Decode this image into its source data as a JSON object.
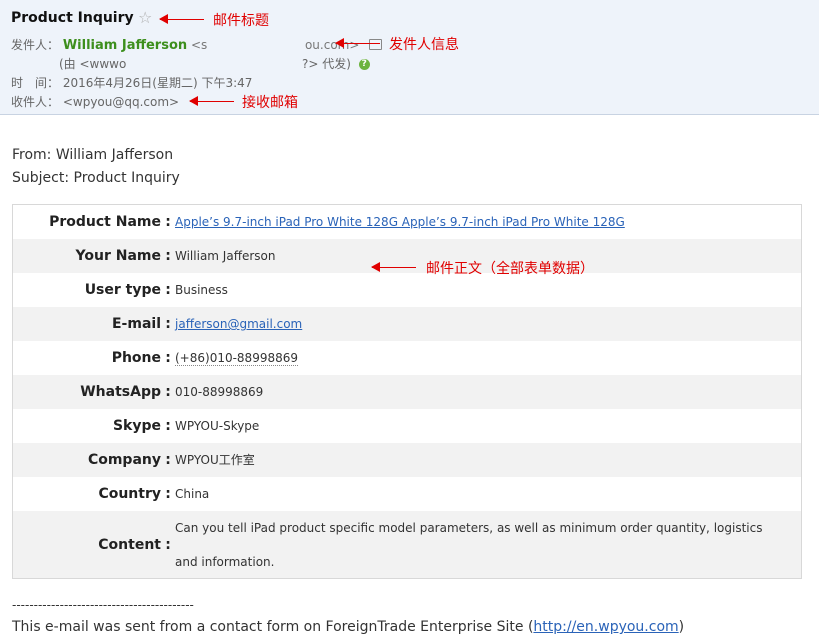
{
  "header": {
    "subject": "Product Inquiry",
    "from_label": "发件人：",
    "sender_name": "William Jafferson",
    "sender_addr_start": "<s",
    "sender_addr_end": "ou.com>",
    "relay_start": "(由 <wwwo",
    "relay_end": "?> 代发)",
    "time_label": "时　间：",
    "time_value": "2016年4月26日(星期二) 下午3:47",
    "to_label": "收件人：",
    "to_value": "<wpyou@qq.com>"
  },
  "annotations": {
    "subject": "邮件标题",
    "sender": "发件人信息",
    "recipient": "接收邮箱",
    "body": "邮件正文（全部表单数据）"
  },
  "body": {
    "from_line": "From: William Jafferson",
    "subject_line": "Subject: Product Inquiry",
    "rows": [
      {
        "label": "Product Name",
        "value": "Apple’s 9.7-inch iPad Pro White 128G Apple’s 9.7-inch iPad Pro White 128G"
      },
      {
        "label": "Your Name",
        "value": "William Jafferson"
      },
      {
        "label": "User type",
        "value": "Business"
      },
      {
        "label": "E-mail",
        "value": "jafferson@gmail.com"
      },
      {
        "label": "Phone",
        "value": "(+86)010-88998869"
      },
      {
        "label": "WhatsApp",
        "value": "010-88998869"
      },
      {
        "label": "Skype",
        "value": "WPYOU-Skype"
      },
      {
        "label": "Company",
        "value": "WPYOU工作室"
      },
      {
        "label": "Country",
        "value": "China"
      },
      {
        "label": "Content",
        "value": "Can you tell iPad product specific model parameters, as well as minimum order quantity, logistics and information."
      }
    ],
    "divider": "------------------------------------------",
    "footer_text": "This e-mail was sent from a contact form on ForeignTrade Enterprise Site (",
    "footer_link": "http://en.wpyou.com",
    "footer_close": ")"
  },
  "colors": {
    "header_bg": "#eef3fa",
    "sender_green": "#3d8f1d",
    "annotation_red": "#e00000",
    "link_blue": "#2a63b8"
  }
}
